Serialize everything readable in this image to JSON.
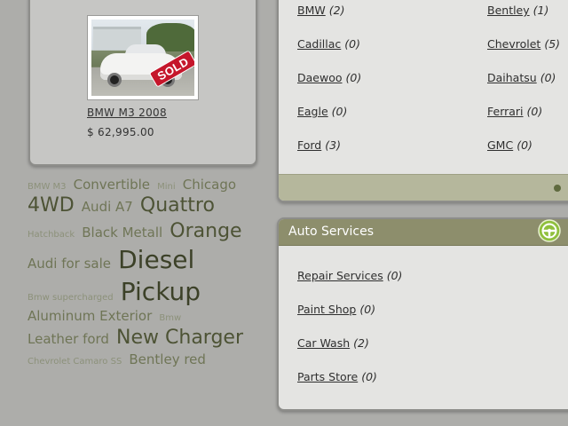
{
  "featured_car": {
    "badge": "SOLD",
    "name": "BMW M3 2008",
    "price": "$ 62,995.00"
  },
  "tag_cloud": [
    {
      "label": "BMW M3",
      "size": 1
    },
    {
      "label": "Convertible",
      "size": 2
    },
    {
      "label": "Mini",
      "size": 1
    },
    {
      "label": "Chicago",
      "size": 2
    },
    {
      "label": "4WD",
      "size": 3
    },
    {
      "label": "Audi A7",
      "size": 2
    },
    {
      "label": "Quattro",
      "size": 3
    },
    {
      "label": "Hatchback",
      "size": 1
    },
    {
      "label": "Black Metall",
      "size": 2
    },
    {
      "label": "Orange",
      "size": 3
    },
    {
      "label": "Audi for sale",
      "size": 2
    },
    {
      "label": "Diesel",
      "size": 4
    },
    {
      "label": "Bmw supercharged",
      "size": 1
    },
    {
      "label": "Pickup",
      "size": 4
    },
    {
      "label": "Aluminum Exterior",
      "size": 2
    },
    {
      "label": "Bmw",
      "size": 1
    },
    {
      "label": "Leather ford",
      "size": 2
    },
    {
      "label": "New Charger",
      "size": 3
    },
    {
      "label": "Chevrolet Camaro SS",
      "size": 1
    },
    {
      "label": "Bentley red",
      "size": 2
    }
  ],
  "brands": [
    {
      "name": "BMW",
      "count": "(2)"
    },
    {
      "name": "Bentley",
      "count": "(1)"
    },
    {
      "name": "Cadillac",
      "count": "(0)"
    },
    {
      "name": "Chevrolet",
      "count": "(5)"
    },
    {
      "name": "Daewoo",
      "count": "(0)"
    },
    {
      "name": "Daihatsu",
      "count": "(0)"
    },
    {
      "name": "Eagle",
      "count": "(0)"
    },
    {
      "name": "Ferrari",
      "count": "(0)"
    },
    {
      "name": "Ford",
      "count": "(3)"
    },
    {
      "name": "GMC",
      "count": "(0)"
    }
  ],
  "auto_services": {
    "title": "Auto Services",
    "icon": "steering-wheel-icon",
    "items": [
      {
        "name": "Repair Services",
        "count": "(0)"
      },
      {
        "name": "Paint Shop",
        "count": "(0)"
      },
      {
        "name": "Car Wash",
        "count": "(2)"
      },
      {
        "name": "Parts Store",
        "count": "(0)"
      }
    ]
  },
  "colors": {
    "accent_green": "#8d8e6c",
    "sold_red": "#c5162b",
    "icon_green": "#8fbf3c"
  }
}
